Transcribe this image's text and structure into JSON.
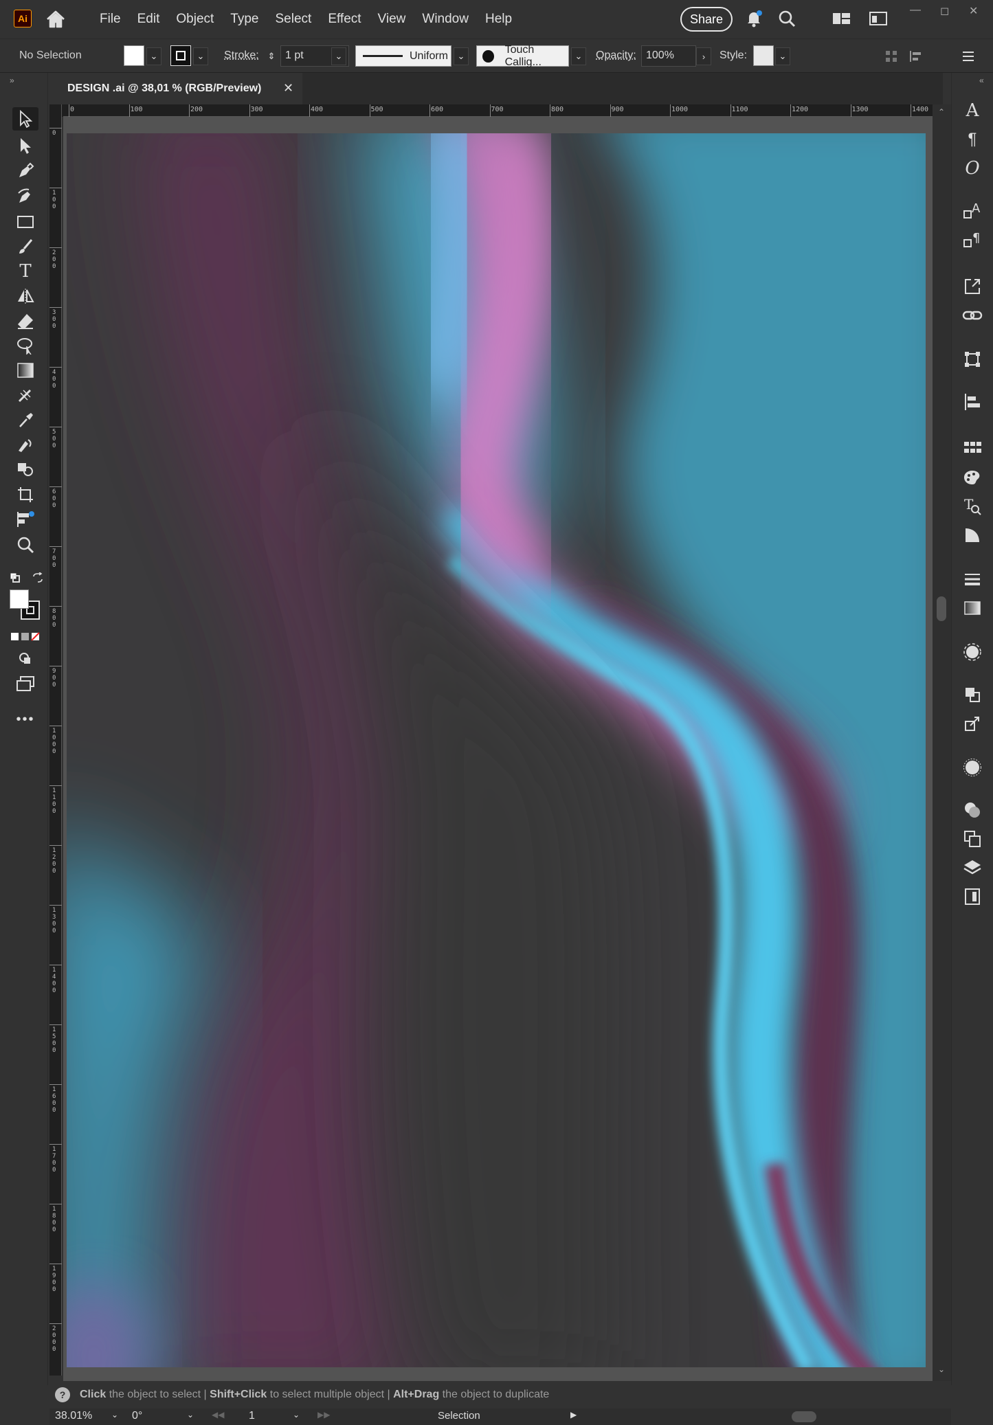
{
  "app": {
    "logo": "Ai"
  },
  "menu": [
    "File",
    "Edit",
    "Object",
    "Type",
    "Select",
    "Effect",
    "View",
    "Window",
    "Help"
  ],
  "topbar": {
    "share_label": "Share",
    "icons": [
      "bell-icon",
      "search-icon",
      "arrange-documents-icon",
      "workspace-icon"
    ]
  },
  "control_bar": {
    "selection_label": "No Selection",
    "stroke_label": "Stroke:",
    "stroke_weight": "1 pt",
    "stroke_profile": "Uniform",
    "brush": "Touch Callig...",
    "opacity_label": "Opacity:",
    "opacity_value": "100%",
    "style_label": "Style:"
  },
  "document_tab": {
    "title": "DESIGN .ai @ 38,01 % (RGB/Preview)"
  },
  "ruler": {
    "h_ticks": [
      "0",
      "100",
      "200",
      "300",
      "400",
      "500",
      "600",
      "700",
      "800",
      "900",
      "1000",
      "1100",
      "1200",
      "1300",
      "1400"
    ],
    "v_ticks": [
      "0",
      "100",
      "200",
      "300",
      "400",
      "500",
      "600",
      "700",
      "800",
      "900",
      "1000",
      "1100",
      "1200",
      "1300",
      "1400",
      "1500",
      "1600",
      "1700",
      "1800",
      "1900",
      "2000"
    ]
  },
  "status": {
    "help_glyph": "?",
    "k1": "Click",
    "t1": " the object to select  |  ",
    "k2": "Shift+Click",
    "t2": " to select multiple object  |  ",
    "k3": "Alt+Drag",
    "t3": " the object to duplicate"
  },
  "bottom": {
    "zoom": "38.01%",
    "rotation": "0°",
    "artboard": "1",
    "mode": "Selection"
  },
  "colors": {
    "teal": "#3f98b5",
    "cyan": "#4dc6ec",
    "magenta": "#d37ac2",
    "plum": "#6b3a5c",
    "dark": "#3a3a3a"
  }
}
